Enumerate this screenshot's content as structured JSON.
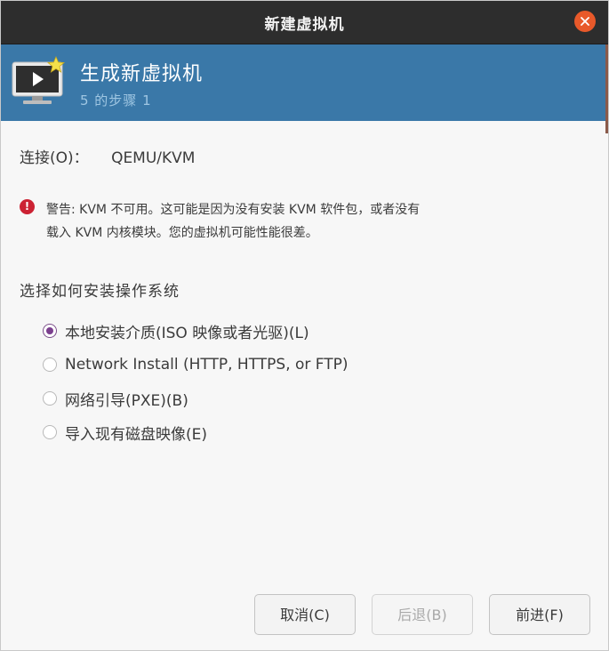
{
  "window": {
    "title": "新建虚拟机"
  },
  "banner": {
    "title": "生成新虚拟机",
    "subtitle": "5 的步骤 1"
  },
  "connection": {
    "label": "连接(O)：",
    "value": "QEMU/KVM"
  },
  "warning": {
    "line1": "警告: KVM 不可用。这可能是因为没有安装 KVM 软件包，或者没有",
    "line2": "载入 KVM 内核模块。您的虚拟机可能性能很差。"
  },
  "install": {
    "title": "选择如何安装操作系统",
    "options": [
      {
        "label": "本地安装介质(ISO 映像或者光驱)(L)",
        "selected": true
      },
      {
        "label": "Network Install (HTTP, HTTPS, or FTP)",
        "selected": false
      },
      {
        "label": "网络引导(PXE)(B)",
        "selected": false
      },
      {
        "label": "导入现有磁盘映像(E)",
        "selected": false
      }
    ]
  },
  "buttons": {
    "cancel": "取消(C)",
    "back": "后退(B)",
    "forward": "前进(F)"
  },
  "colors": {
    "titlebar": "#2d2d2d",
    "banner": "#3a78a8",
    "close": "#e8592a",
    "radio_accent": "#7b3f8e",
    "warning": "#cc2233"
  },
  "icons": {
    "close": "close-icon",
    "vm": "new-vm-monitor-icon",
    "warning": "error-icon"
  }
}
